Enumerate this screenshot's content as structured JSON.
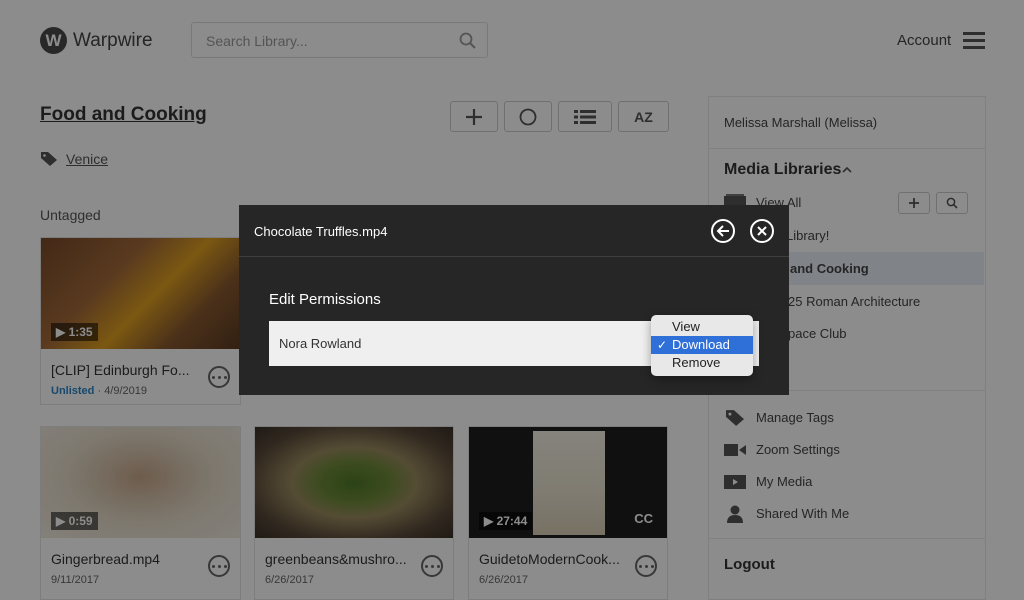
{
  "header": {
    "logo_letter": "W",
    "logo_text": "Warpwire",
    "search_placeholder": "Search Library...",
    "account_label": "Account"
  },
  "library": {
    "title": "Food and Cooking",
    "tag": "Venice",
    "section_label": "Untagged",
    "toolbar": {
      "sort_label": "AZ"
    }
  },
  "videos": [
    {
      "title": "[CLIP] Edinburgh Fo...",
      "status": "Unlisted",
      "date": "4/9/2019",
      "duration": "1:35"
    },
    {
      "title": "Gingerbread.mp4",
      "date": "9/11/2017",
      "duration": "0:59"
    },
    {
      "title": "greenbeans&mushro...",
      "date": "6/26/2017"
    },
    {
      "title": "GuidetoModernCook...",
      "date": "6/26/2017",
      "duration": "27:44",
      "cc": "CC"
    }
  ],
  "sidebar": {
    "user": "Melissa Marshall (Melissa)",
    "media_libraries_label": "Media Libraries",
    "view_all": "View All",
    "libraries": [
      "Library!",
      "and Cooking",
      "25 Roman Architecture",
      "pace Club"
    ],
    "menu": [
      "Manage Tags",
      "Zoom Settings",
      "My Media",
      "Shared With Me"
    ],
    "logout": "Logout"
  },
  "modal": {
    "title": "Chocolate Truffles.mp4",
    "section": "Edit Permissions",
    "person": "Nora Rowland"
  },
  "dropdown": {
    "options": [
      "View",
      "Download",
      "Remove"
    ],
    "selected": "Download"
  },
  "colors": {
    "accent_blue": "#2f6fd8",
    "unlisted_blue": "#2c86c5",
    "modal_bg": "#262626"
  }
}
